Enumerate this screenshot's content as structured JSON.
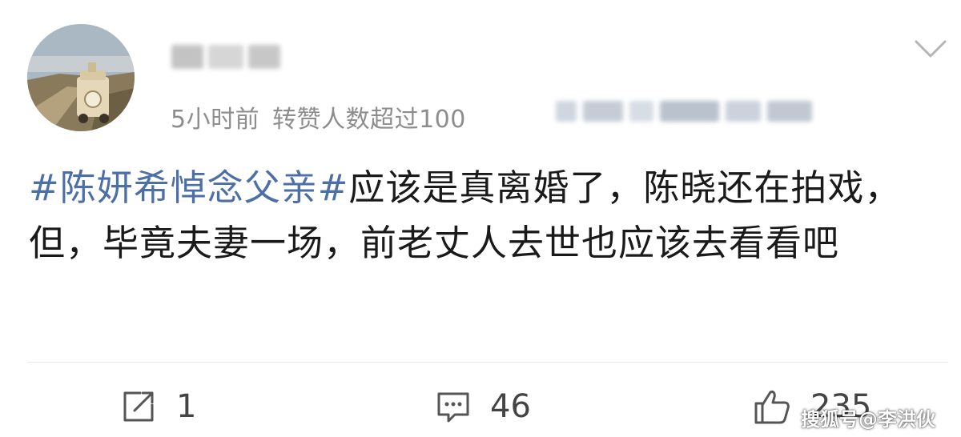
{
  "post": {
    "meta": {
      "time": "5小时前",
      "repost_note": "转赞人数超过100"
    },
    "hashtag": "#陈妍希悼念父亲#",
    "body": "应该是真离婚了，陈晓还在拍戏，但，毕竟夫妻一场，前老丈人去世也应该去看看吧"
  },
  "actions": {
    "repost_count": "1",
    "comment_count": "46",
    "like_count": "235"
  },
  "watermark": {
    "text": "搜狐号@李洪伙"
  },
  "icons": {
    "more": "chevron-down-icon",
    "repost": "share-icon",
    "comment": "comment-icon",
    "like": "thumbs-up-icon"
  },
  "colors": {
    "hashtag": "#4d6fa8",
    "meta": "#8d8d8d",
    "body_text": "#1a1a1a"
  }
}
